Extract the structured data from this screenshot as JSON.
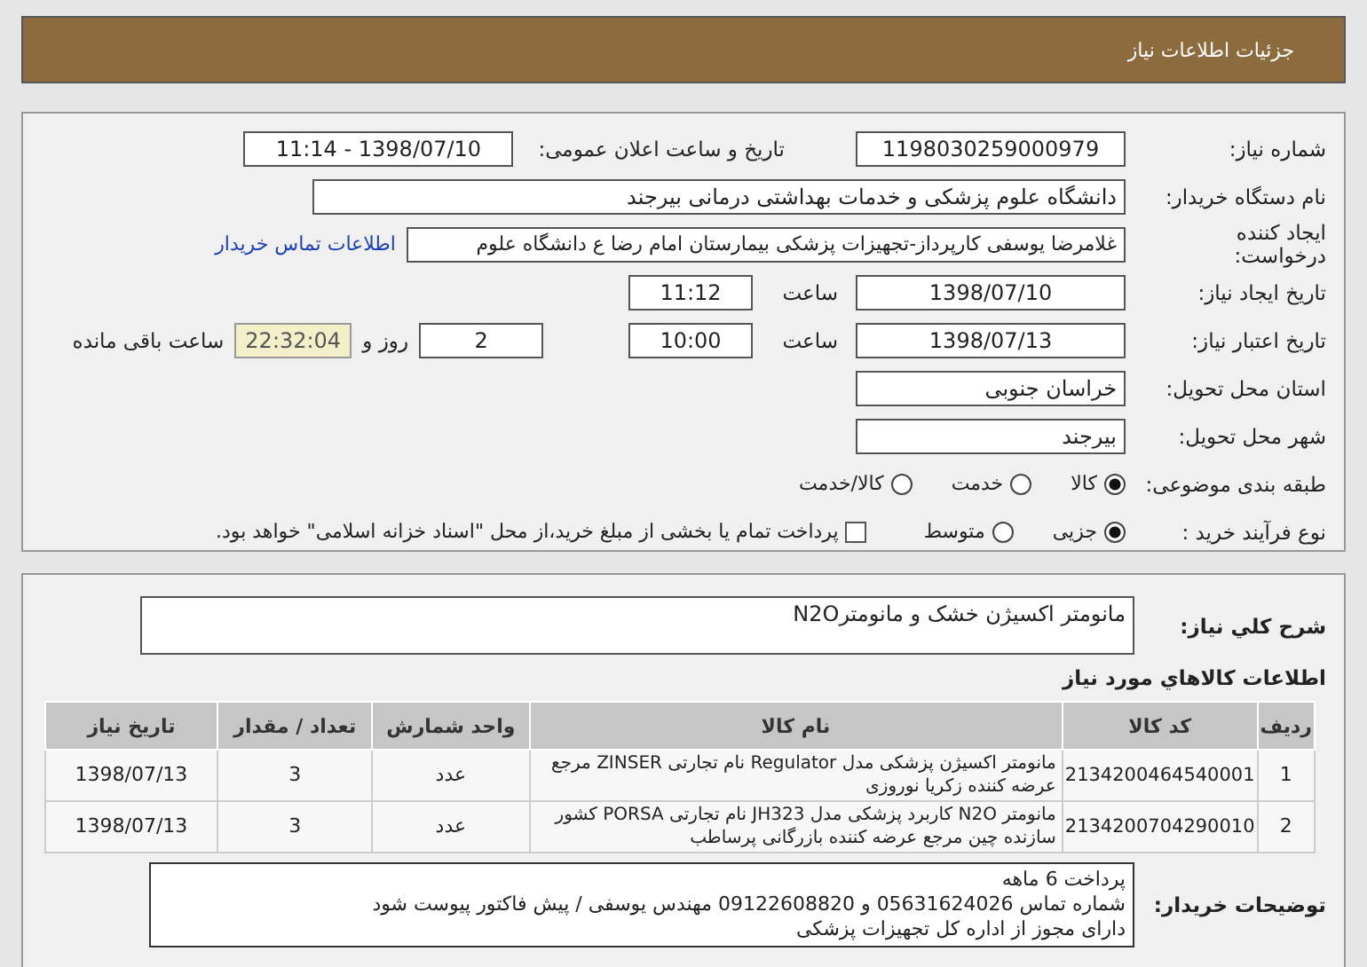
{
  "header": {
    "title": "جزئیات اطلاعات نیاز"
  },
  "need": {
    "number": {
      "label": "شماره نیاز:",
      "value": "1198030259000979"
    },
    "announce": {
      "label": "تاریخ و ساعت اعلان عمومی:",
      "value": "1398/07/10 - 11:14"
    },
    "buyer": {
      "label": "نام دستگاه خریدار:",
      "value": "دانشگاه علوم پزشکی و خدمات بهداشتی درمانی بیرجند"
    },
    "requester": {
      "label": "ایجاد کننده درخواست:",
      "value": "غلامرضا یوسفی کارپرداز-تجهیزات پزشکی بیمارستان امام رضا ع دانشگاه علوم",
      "link": "اطلاعات تماس خریدار"
    },
    "created": {
      "label": "تاریخ ایجاد نیاز:",
      "date": "1398/07/10",
      "time_label": "ساعت",
      "time": "11:12"
    },
    "validity": {
      "label": "تاریخ اعتبار نیاز:",
      "date": "1398/07/13",
      "time_label": "ساعت",
      "time": "10:00",
      "days": "2",
      "days_label": "روز و",
      "remaining": "22:32:04",
      "remaining_label": "ساعت باقی مانده"
    },
    "province": {
      "label": "استان محل تحویل:",
      "value": "خراسان جنوبی"
    },
    "city": {
      "label": "شهر محل تحویل:",
      "value": "بیرجند"
    },
    "category": {
      "label": "طبقه بندی موضوعی:",
      "options": [
        {
          "label": "کالا",
          "selected": true
        },
        {
          "label": "خدمت",
          "selected": false
        },
        {
          "label": "کالا/خدمت",
          "selected": false
        }
      ]
    },
    "process": {
      "label": "نوع فرآیند خرید :",
      "options": [
        {
          "label": "جزیی",
          "selected": true
        },
        {
          "label": "متوسط",
          "selected": false
        }
      ],
      "treasury": {
        "label": "پرداخت تمام یا بخشی از مبلغ خرید،از محل \"اسناد خزانه اسلامی\" خواهد بود.",
        "checked": false
      }
    }
  },
  "details": {
    "description": {
      "label": "شرح کلي نیاز:",
      "value": "مانومتر اکسیژن خشک و مانومترN2O"
    },
    "goods_title": "اطلاعات کالاهاي مورد نیاز",
    "table": {
      "columns": [
        "ردیف",
        "کد کالا",
        "نام کالا",
        "واحد شمارش",
        "تعداد / مقدار",
        "تاریخ نیاز"
      ],
      "rows": [
        {
          "cells": [
            "1",
            "2134200464540001",
            "مانومتر اکسیژن پزشکی مدل Regulator نام تجارتی ZINSER مرجع عرضه کننده زکریا نوروزی",
            "عدد",
            "3",
            "1398/07/13"
          ]
        },
        {
          "cells": [
            "2",
            "2134200704290010",
            "مانومتر N2O کاربرد پزشکی مدل JH323 نام تجارتی PORSA کشور سازنده چین مرجع عرضه کننده بازرگانی پرساطب",
            "عدد",
            "3",
            "1398/07/13"
          ]
        }
      ]
    },
    "notes": {
      "label": "توضیحات خریدار:",
      "lines": [
        "پرداخت 6 ماهه",
        "شماره تماس 05631624026 و 09122608820 مهندس یوسفی / پیش فاکتور پیوست شود",
        "دارای مجوز از اداره کل تجهیزات پزشکی"
      ]
    }
  }
}
